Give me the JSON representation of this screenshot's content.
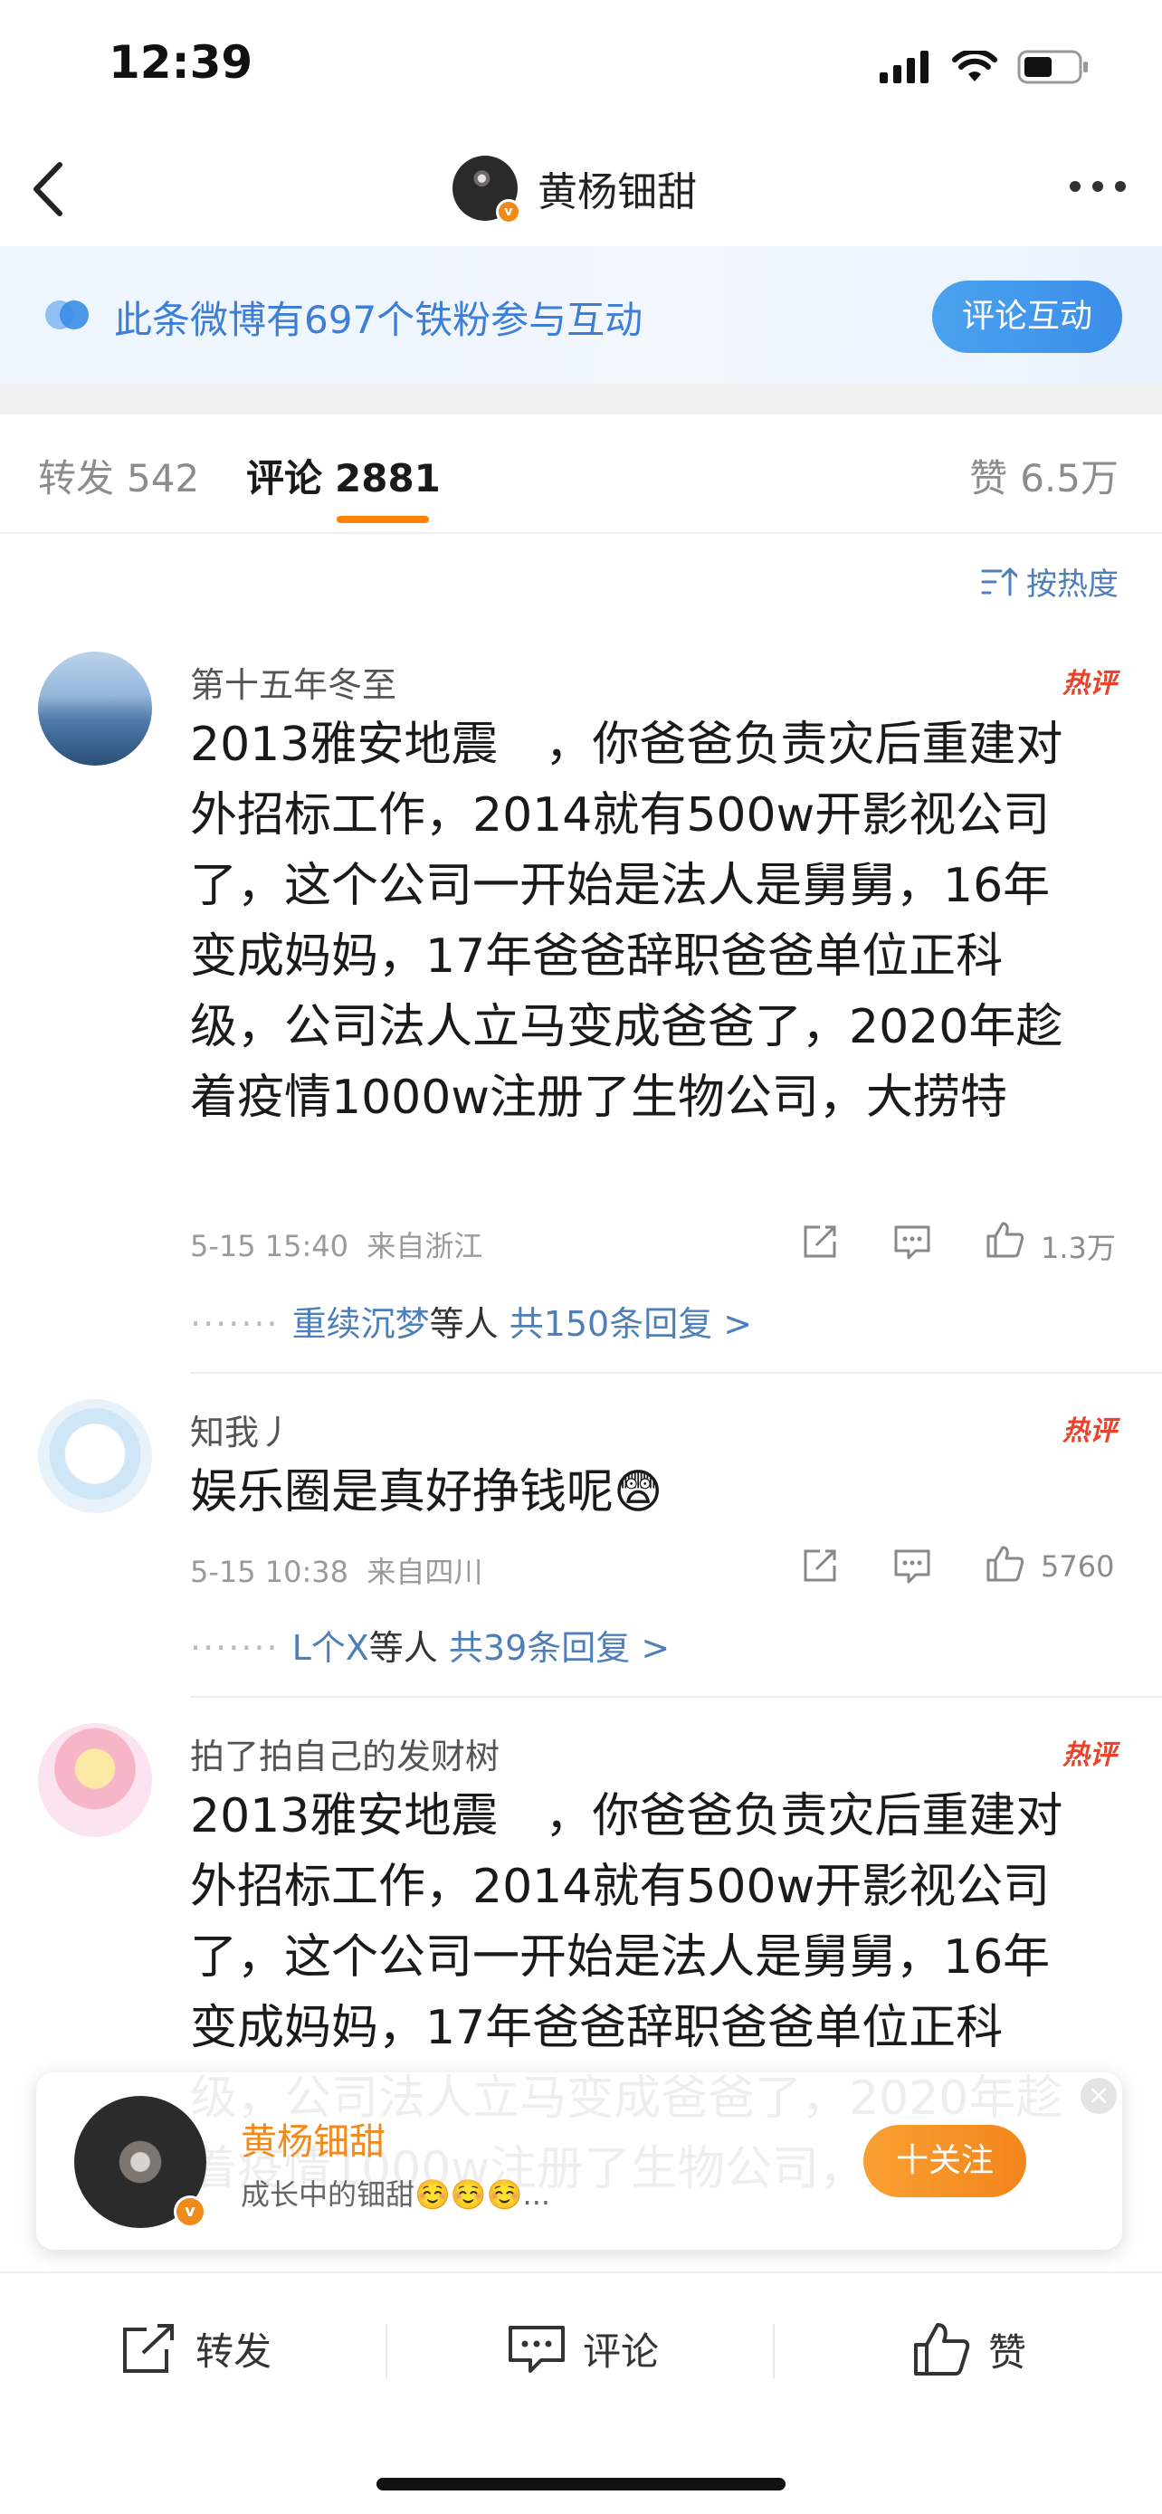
{
  "status_bar": {
    "time": "12:39"
  },
  "header": {
    "title": "黄杨钿甜"
  },
  "banner": {
    "text": "此条微博有697个铁粉参与互动",
    "button": "评论互动"
  },
  "tabs": [
    {
      "label": "转发",
      "count": "542"
    },
    {
      "label": "评论",
      "count": "2881"
    },
    {
      "label": "赞",
      "count": "6.5万"
    }
  ],
  "sort_label": "按热度",
  "comments": [
    {
      "user": "第十五年冬至",
      "badge": "热评",
      "text": "2013雅安地震　，你爸爸负责灾后重建对外招标工作，2014就有500w开影视公司了，这个公司一开始是法人是舅舅，16年变成妈妈，17年爸爸辞职爸爸单位正科级，公司法人立马变成爸爸了，2020年趁着疫情1000w注册了生物公司，大捞特",
      "time": "5-15 15:40",
      "location": "来自浙江",
      "likes": "1.3万",
      "reply_users": "重续沉梦",
      "reply_suffix": "等人",
      "reply_count": "共150条回复 >"
    },
    {
      "user": "知我丿",
      "badge": "热评",
      "text": "娱乐圈是真好挣钱呢😨",
      "time": "5-15 10:38",
      "location": "来自四川",
      "likes": "5760",
      "reply_users": "L个X",
      "reply_suffix": "等人",
      "reply_count": "共39条回复 >"
    },
    {
      "user": "拍了拍自己的发财树",
      "badge": "热评",
      "text": "2013雅安地震　，你爸爸负责灾后重建对外招标工作，2014就有500w开影视公司了，这个公司一开始是法人是舅舅，16年变成妈妈，17年爸爸辞职爸爸单位正科级，公司法人立马变成爸爸了，2020年趁着疫情1000w注册了生物公司，大捞特"
    }
  ],
  "follow_card": {
    "name": "黄杨钿甜",
    "subtitle": "成长中的钿甜☺️☺️☺️...",
    "button": "十关注"
  },
  "bottom_bar": {
    "repost": "转发",
    "comment": "评论",
    "like": "赞"
  },
  "colors": {
    "accent": "#ff8200",
    "link": "#4e7fb8",
    "hot": "#e8442c"
  }
}
